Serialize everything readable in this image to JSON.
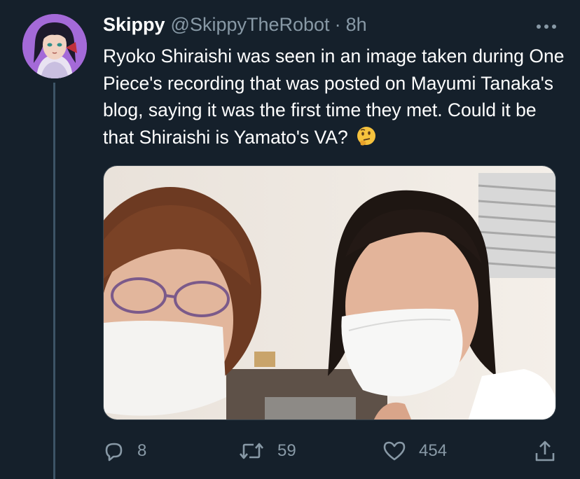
{
  "tweet": {
    "author": {
      "name": "Skippy",
      "handle": "@SkippyTheRobot",
      "separator": "·",
      "time": "8h"
    },
    "text": "Ryoko Shiraishi was seen in an image taken during One Piece's recording that was posted on Mayumi Tanaka's blog, saying it was the first time they met. Could it be that Shiraishi is Yamato's VA?",
    "emoji": "thinking-face",
    "stats": {
      "replies": "8",
      "retweets": "59",
      "likes": "454"
    },
    "icons": {
      "more": "more-icon",
      "reply": "reply-icon",
      "retweet": "retweet-icon",
      "like": "heart-icon",
      "share": "share-icon"
    }
  },
  "colors": {
    "background": "#15202b",
    "secondary_text": "#8899a6",
    "thread_line": "#3d5466"
  }
}
